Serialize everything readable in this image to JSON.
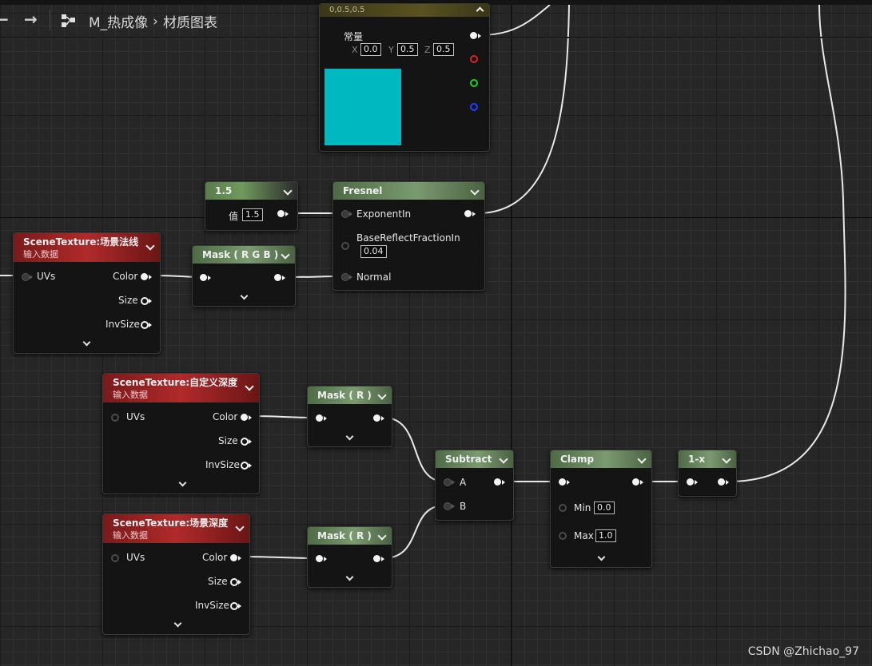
{
  "toolbar": {
    "back_icon": "arrow-left-icon",
    "forward_icon": "arrow-right-icon",
    "graph_icon": "material-graph-icon",
    "asset_name": "M_热成像",
    "graph_name": "材质图表"
  },
  "nodes": {
    "constant3": {
      "title": "0,0.5,0.5",
      "label": "常量",
      "x_label": "X",
      "x_value": "0.0",
      "y_label": "Y",
      "y_value": "0.5",
      "z_label": "Z",
      "z_value": "0.5",
      "swatch_color": "#00b8bf"
    },
    "scalar": {
      "title": "1.5",
      "value_label": "值",
      "value": "1.5"
    },
    "fresnel": {
      "title": "Fresnel",
      "pin_exponent": "ExponentIn",
      "pin_base": "BaseReflectFractionIn",
      "base_value": "0.04",
      "pin_normal": "Normal"
    },
    "scene_normal": {
      "title": "SceneTexture:场景法线",
      "subtitle": "输入数据",
      "pin_uvs": "UVs",
      "pin_color": "Color",
      "pin_size": "Size",
      "pin_invsize": "InvSize"
    },
    "mask_rgb": {
      "title": "Mask ( R G B )"
    },
    "scene_custom_depth": {
      "title": "SceneTexture:自定义深度",
      "subtitle": "输入数据",
      "pin_uvs": "UVs",
      "pin_color": "Color",
      "pin_size": "Size",
      "pin_invsize": "InvSize"
    },
    "mask_r1": {
      "title": "Mask ( R )"
    },
    "scene_depth": {
      "title": "SceneTexture:场景深度",
      "subtitle": "输入数据",
      "pin_uvs": "UVs",
      "pin_color": "Color",
      "pin_size": "Size",
      "pin_invsize": "InvSize"
    },
    "mask_r2": {
      "title": "Mask ( R )"
    },
    "subtract": {
      "title": "Subtract",
      "pin_a": "A",
      "pin_b": "B"
    },
    "clamp": {
      "title": "Clamp",
      "min_label": "Min",
      "min_value": "0.0",
      "max_label": "Max",
      "max_value": "1.0"
    },
    "one_minus": {
      "title": "1-x"
    }
  },
  "colors": {
    "background": "#262626",
    "wire": "#e8e8e8",
    "pin_red": "#e02020",
    "pin_green": "#20d020",
    "pin_blue": "#2040ff"
  },
  "watermark": "CSDN @Zhichao_97"
}
